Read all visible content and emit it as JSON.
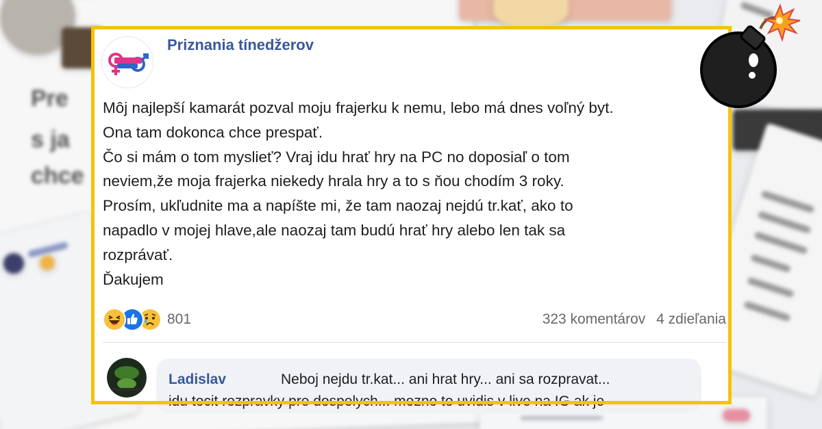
{
  "post": {
    "page_name": "Priznania tínedžerov",
    "logo_text": "Priznania tínedžerov",
    "body_lines": [
      "Môj najlepší kamarát pozval moju frajerku k nemu, lebo má dnes voľný byt.",
      "Ona tam dokonca chce prespať.",
      "Čo si mám o tom myslieť? Vraj idu hrať hry na PC no doposiaľ o tom",
      "neviem,že moja frajerka niekedy hrala hry a to s ňou chodím 3 roky.",
      "Prosím, ukľudnite ma a napíšte mi, že tam naozaj nejdú tr.kať, ako to",
      "napadlo v mojej hlave,ale naozaj tam budú hrať hry alebo len tak sa",
      "rozprávať.",
      "Ďakujem"
    ],
    "reactions": {
      "icons": [
        "haha-icon",
        "like-icon",
        "sad-icon"
      ],
      "count": "801"
    },
    "comments_count": "323 komentárov",
    "shares_count": "4 zdieľania"
  },
  "comment": {
    "author": "Ladislav",
    "text_line1": "Neboj nejdu tr.kat... ani hrat hry... ani sa rozpravat...",
    "text_line2": "idu tocit rozpravky pre dospelych... mozno to uvidis v live na IG ak je"
  },
  "decoration": {
    "icon": "bomb-icon",
    "frame_color": "#f5c20a",
    "link_color": "#385898"
  }
}
